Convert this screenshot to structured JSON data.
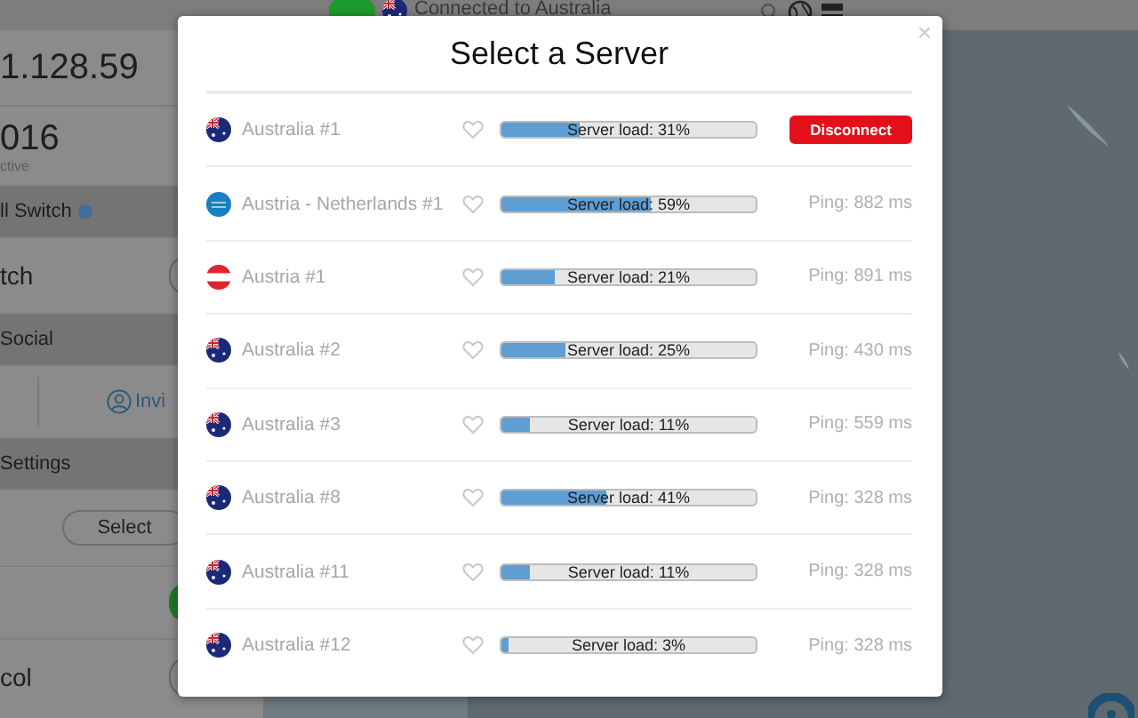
{
  "background": {
    "status": "Connected to Australia",
    "ip": "1.128.59",
    "date": "016",
    "date_caption": "ctive",
    "kill_switch_header": "ll Switch",
    "switch_label": "tch",
    "social_header": "Social",
    "invite": "Invi",
    "settings_header": "Settings",
    "select_button": "Select",
    "protocol_label": "col",
    "toggles": [
      {
        "on": true
      },
      {
        "on": false
      },
      {
        "on": true
      },
      {
        "on": false
      }
    ]
  },
  "dialog": {
    "title": "Select a Server",
    "close": "×",
    "servers": [
      {
        "name": "Australia #1",
        "kind": "australia",
        "level": 0.31,
        "load": "Server load: 31%",
        "connected": true,
        "button": "Disconnect"
      },
      {
        "name": "Austria - Netherlands #1",
        "kind": "double",
        "level": 0.59,
        "load": "Server load: 59%",
        "connected": false,
        "ping": "Ping: 882 ms"
      },
      {
        "name": "Austria #1",
        "kind": "austria",
        "level": 0.21,
        "load": "Server load: 21%",
        "connected": false,
        "ping": "Ping: 891 ms"
      },
      {
        "name": "Australia #2",
        "kind": "australia",
        "level": 0.25,
        "load": "Server load: 25%",
        "connected": false,
        "ping": "Ping: 430 ms"
      },
      {
        "name": "Australia #3",
        "kind": "australia",
        "level": 0.11,
        "load": "Server load: 11%",
        "connected": false,
        "ping": "Ping: 559 ms"
      },
      {
        "name": "Australia #8",
        "kind": "australia",
        "level": 0.41,
        "load": "Server load: 41%",
        "connected": false,
        "ping": "Ping: 328 ms"
      },
      {
        "name": "Australia #11",
        "kind": "australia",
        "level": 0.11,
        "load": "Server load: 11%",
        "connected": false,
        "ping": "Ping: 328 ms"
      },
      {
        "name": "Australia #12",
        "kind": "australia",
        "level": 0.03,
        "load": "Server load: 3%",
        "connected": false,
        "ping": "Ping: 328 ms"
      }
    ]
  }
}
